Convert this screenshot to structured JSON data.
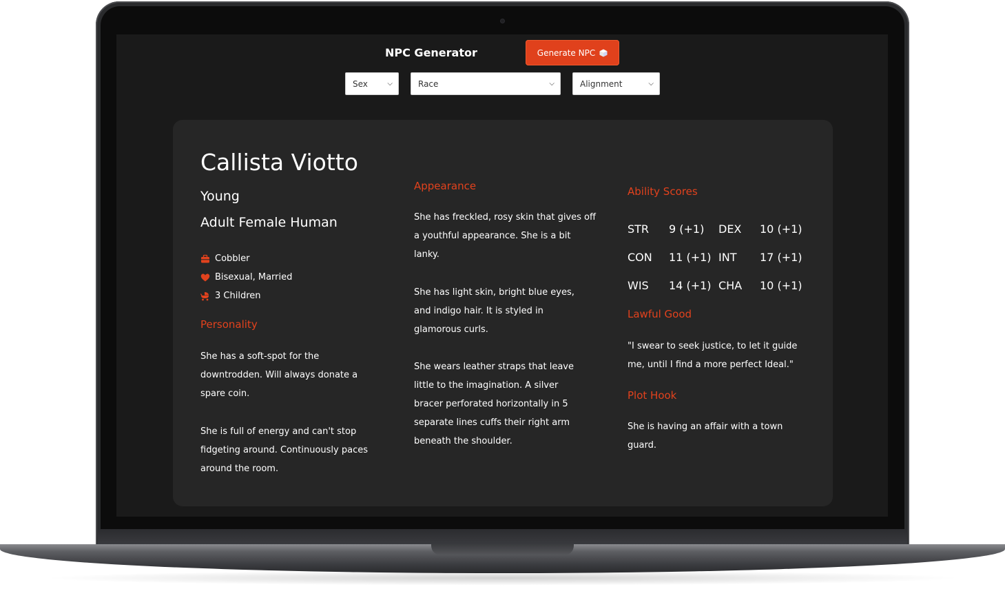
{
  "app": {
    "title": "NPC Generator",
    "generate_label": "Generate NPC",
    "filters": {
      "sex": "Sex",
      "race": "Race",
      "alignment": "Alignment"
    }
  },
  "npc": {
    "name": "Callista  Viotto",
    "age": "Young",
    "description": "Adult Female Human",
    "occupation": "Cobbler",
    "relationship": "Bisexual, Married",
    "children": "3 Children",
    "personality_heading": "Personality",
    "personality": [
      "She has a soft-spot for the downtrodden. Will always donate a spare coin.",
      "She is full of energy and can't stop fidgeting around. Continuously paces around the room."
    ],
    "appearance_heading": "Appearance",
    "appearance": [
      "She has freckled, rosy skin that gives off a youthful appearance. She is a bit lanky.",
      "She has light skin, bright blue eyes, and indigo hair. It is styled in glamorous curls.",
      "She wears leather straps that leave little to the imagination. A silver bracer perforated horizontally in 5 separate lines cuffs their right arm beneath the shoulder."
    ],
    "ability_heading": "Ability Scores",
    "abilities": [
      {
        "label": "STR",
        "value": "9 (+1)"
      },
      {
        "label": "DEX",
        "value": "10 (+1)"
      },
      {
        "label": "CON",
        "value": "11 (+1)"
      },
      {
        "label": "INT",
        "value": "17 (+1)"
      },
      {
        "label": "WIS",
        "value": "14 (+1)"
      },
      {
        "label": "CHA",
        "value": "10 (+1)"
      }
    ],
    "alignment_heading": "Lawful Good",
    "alignment_quote": "\"I swear to seek justice, to let it guide me, until I find a more perfect Ideal.\"",
    "plot_heading": "Plot Hook",
    "plot": "She is having an affair with a town guard."
  },
  "colors": {
    "accent": "#e2421d",
    "card": "#262626",
    "screen": "#1a1a1a"
  }
}
